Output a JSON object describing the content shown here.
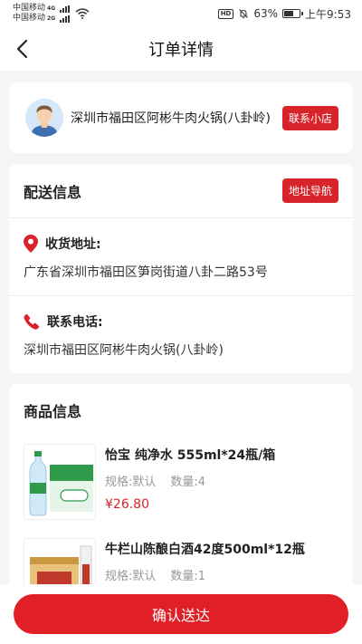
{
  "status_bar": {
    "carrier_1": "中国移动",
    "carrier_1_net": "4G",
    "carrier_2": "中国移动",
    "carrier_2_net": "2G",
    "hd_label": "HD",
    "battery_text": "63%",
    "battery_level": 0.63,
    "time": "上午9:53"
  },
  "nav": {
    "title": "订单详情"
  },
  "shop": {
    "name": "深圳市福田区阿彬牛肉火锅(八卦岭)",
    "contact_button": "联系小店"
  },
  "delivery": {
    "title": "配送信息",
    "nav_button": "地址导航",
    "address_label": "收货地址:",
    "address_value": "广东省深圳市福田区笋岗街道八卦二路53号",
    "phone_label": "联系电话:",
    "phone_value": "深圳市福田区阿彬牛肉火锅(八卦岭)"
  },
  "goods": {
    "title": "商品信息",
    "items": [
      {
        "name": "怡宝 纯净水 555ml*24瓶/箱",
        "spec": "规格:默认",
        "qty": "数量:4",
        "price": "¥26.80"
      },
      {
        "name": "牛栏山陈酿白酒42度500ml*12瓶",
        "spec": "规格:默认",
        "qty": "数量:1",
        "price": ""
      }
    ]
  },
  "footer": {
    "confirm_button": "确认送达"
  },
  "colors": {
    "accent": "#d8232a",
    "background": "#f5f5f5"
  }
}
